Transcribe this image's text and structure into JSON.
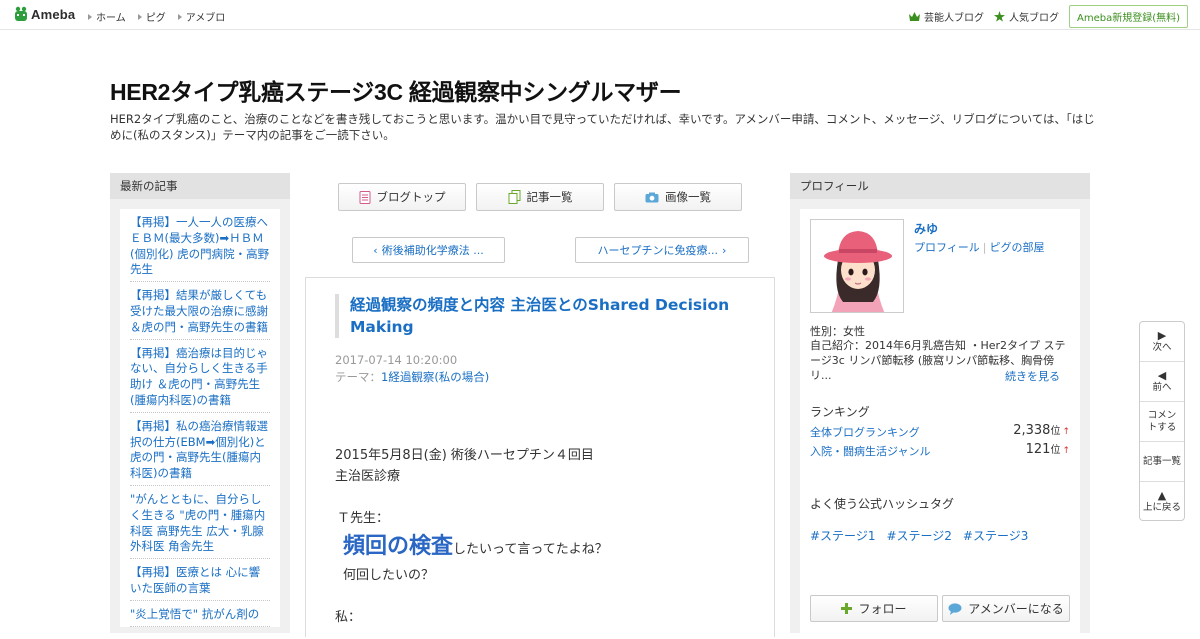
{
  "topbar": {
    "logo_text": "Ameba",
    "nav": [
      "ホーム",
      "ピグ",
      "アメブロ"
    ],
    "right_links": [
      {
        "label": "芸能人ブログ",
        "icon": "crown-icon"
      },
      {
        "label": "人気ブログ",
        "icon": "star-icon"
      }
    ],
    "signup_label": "Ameba新規登録(無料)"
  },
  "blog": {
    "title": "HER2タイプ乳癌ステージ3C 経過観察中シングルマザー",
    "description": "HER2タイプ乳癌のこと、治療のことなどを書き残しておこうと思います。温かい目で見守っていただければ、幸いです。アメンバー申請、コメント、メッセージ、リブログについては、「はじめに(私のスタンス)」テーマ内の記事をご一読下さい。"
  },
  "left": {
    "heading": "最新の記事",
    "recent": [
      "【再掲】一人一人の医療へ ＥＢＭ(最大多数)➡ＨＢＭ(個別化) 虎の門病院・高野先生",
      "【再掲】結果が厳しくても受けた最大限の治療に感謝 ＆虎の門・高野先生の書籍",
      "【再掲】癌治療は目的じゃない、自分らしく生きる手助け ＆虎の門・高野先生(腫瘍内科医)の書籍",
      "【再掲】私の癌治療情報選択の仕方(EBM➡個別化)と虎の門・高野先生(腫瘍内科医)の書籍",
      "\"がんとともに、自分らしく生きる \"虎の門・腫瘍内科医 高野先生 広大・乳腺外科医 角舎先生",
      "【再掲】医療とは 心に響いた医師の言葉",
      "\"炎上覚悟で\" 抗がん剤の"
    ]
  },
  "center": {
    "tabs": [
      {
        "label": "ブログトップ",
        "icon": "document-icon"
      },
      {
        "label": "記事一覧",
        "icon": "copy-icon"
      },
      {
        "label": "画像一覧",
        "icon": "camera-icon"
      }
    ],
    "prev_label": "術後補助化学療法 ...",
    "next_label": "ハーセプチンに免疫療...",
    "entry": {
      "title": "経過観察の頻度と内容 主治医とのShared Decision Making",
      "date": "2017-07-14 10:20:00",
      "theme_prefix": "テーマ：",
      "theme": "1経過観察(私の場合)",
      "line1": "2015年5月8日(金)  術後ハーセプチン４回目",
      "line2": "主治医診療",
      "line3": "Ｔ先生：",
      "line4_big": "頻回の検査",
      "line4_rest": "したいって言ってたよね？",
      "line5": "何回したいの？",
      "line6": "私："
    }
  },
  "right": {
    "heading": "プロフィール",
    "name": "みゆ",
    "link_profile": "プロフィール",
    "link_pig": "ピグの部屋",
    "gender": "性別：女性",
    "intro": "自己紹介：2014年6月乳癌告知 ・Her2タイプ ステージ3c リンパ節転移 (腋窩リンパ節転移、胸骨傍リ...",
    "more": "続きを見る",
    "ranking_heading": "ランキング",
    "ranking": [
      {
        "label": "全体ブログランキング",
        "value": "2,338",
        "unit": "位",
        "arrow": "↑"
      },
      {
        "label": "入院・闘病生活ジャンル",
        "value": "121",
        "unit": "位",
        "arrow": "↑"
      }
    ],
    "hashtag_heading": "よく使う公式ハッシュタグ",
    "hashtags": [
      "#ステージ1",
      "#ステージ2",
      "#ステージ3"
    ],
    "follow_label": "フォロー",
    "amember_label": "アメンバーになる"
  },
  "sidenav": {
    "next": "次へ",
    "prev": "前へ",
    "comment": "コメントする",
    "list": "記事一覧",
    "top": "上に戻る"
  },
  "colors": {
    "link": "#1a6fc4",
    "ameba_green": "#3b8f1e",
    "column_bg": "#f0f0f0"
  }
}
